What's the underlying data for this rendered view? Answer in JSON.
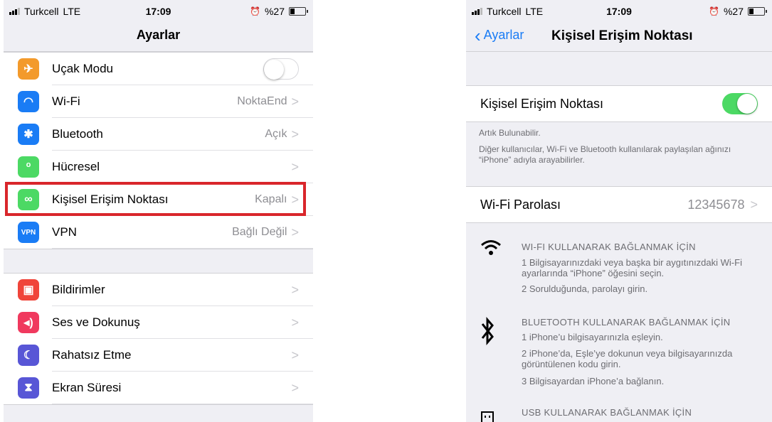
{
  "left": {
    "status": {
      "carrier": "Turkcell",
      "network": "LTE",
      "time": "17:09",
      "battery": "%27",
      "battery_level": 0.27
    },
    "title": "Ayarlar",
    "group1": [
      {
        "label": "Uçak Modu",
        "value": "",
        "icon": "airplane-icon",
        "color": "#f39a2b",
        "glyph": "✈"
      },
      {
        "label": "Wi-Fi",
        "value": "NoktaEnd",
        "icon": "wifi-icon",
        "color": "#1a7cf5",
        "glyph": "◠"
      },
      {
        "label": "Bluetooth",
        "value": "Açık",
        "icon": "bluetooth-icon",
        "color": "#1a7cf5",
        "glyph": "✱"
      },
      {
        "label": "Hücresel",
        "value": "",
        "icon": "cellular-icon",
        "color": "#4cd964",
        "glyph": "ᵒ"
      },
      {
        "label": "Kişisel Erişim Noktası",
        "value": "Kapalı",
        "icon": "hotspot-icon",
        "color": "#4cd964",
        "glyph": "∞"
      },
      {
        "label": "VPN",
        "value": "Bağlı Değil",
        "icon": "vpn-icon",
        "color": "#1a7cf5",
        "glyph": "VPN"
      }
    ],
    "group2": [
      {
        "label": "Bildirimler",
        "icon": "notifications-icon",
        "color": "#f0443a",
        "glyph": "▣"
      },
      {
        "label": "Ses ve Dokunuş",
        "icon": "sound-icon",
        "color": "#f0395e",
        "glyph": "◂)"
      },
      {
        "label": "Rahatsız Etme",
        "icon": "moon-icon",
        "color": "#5856d6",
        "glyph": "☾"
      },
      {
        "label": "Ekran Süresi",
        "icon": "hourglass-icon",
        "color": "#5856d6",
        "glyph": "⧗"
      }
    ]
  },
  "right": {
    "status": {
      "carrier": "Turkcell",
      "network": "LTE",
      "time": "17:09",
      "battery": "%27",
      "battery_level": 0.27
    },
    "back_label": "Ayarlar",
    "title": "Kişisel Erişim Noktası",
    "hotspot_label": "Kişisel Erişim Noktası",
    "note1": "Artık Bulunabilir.",
    "note2": "Diğer kullanıcılar, Wi-Fi ve Bluetooth kullanılarak paylaşılan ağınızı “iPhone” adıyla arayabilirler.",
    "wifi_password_label": "Wi-Fi Parolası",
    "wifi_password_value": "12345678",
    "wifi_title": "WI-FI KULLANARAK BAĞLANMAK İÇİN",
    "wifi_step1": "1 Bilgisayarınızdaki veya başka bir aygıtınızdaki Wi-Fi ayarlarında “iPhone” öğesini seçin.",
    "wifi_step2": "2 Sorulduğunda, parolayı girin.",
    "bt_title": "BLUETOOTH KULLANARAK BAĞLANMAK İÇİN",
    "bt_step1": "1 iPhone’u bilgisayarınızla eşleyin.",
    "bt_step2": "2 iPhone’da, Eşle’ye dokunun veya bilgisayarınızda görüntülenen kodu girin.",
    "bt_step3": "3 Bilgisayardan iPhone’a bağlanın.",
    "usb_title": "USB KULLANARAK BAĞLANMAK İÇİN"
  }
}
